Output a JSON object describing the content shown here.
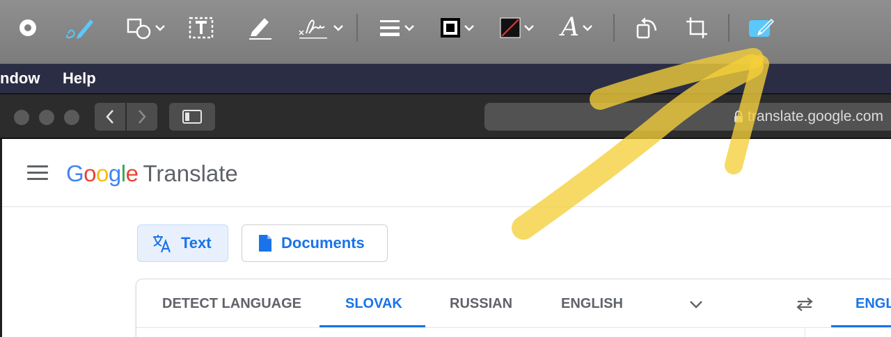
{
  "toolbar": {
    "tools": [
      {
        "name": "record-icon"
      },
      {
        "name": "sketch-icon"
      },
      {
        "name": "shapes-icon"
      },
      {
        "name": "text-box-icon"
      },
      {
        "name": "highlight-icon"
      },
      {
        "name": "signature-icon"
      },
      {
        "name": "line-style-icon"
      },
      {
        "name": "border-color-icon"
      },
      {
        "name": "fill-color-icon"
      },
      {
        "name": "text-style-icon"
      },
      {
        "name": "rotate-icon"
      },
      {
        "name": "crop-icon"
      },
      {
        "name": "annotate-icon"
      }
    ],
    "text_style_glyph": "A",
    "accent_color": "#5ac8fa"
  },
  "menubar": {
    "items": [
      "ndow",
      "Help"
    ]
  },
  "browser": {
    "url": "translate.google.com"
  },
  "app": {
    "logo_parts": [
      {
        "text": "G",
        "color": "#4285f4"
      },
      {
        "text": "o",
        "color": "#ea4335"
      },
      {
        "text": "o",
        "color": "#fbbc05"
      },
      {
        "text": "g",
        "color": "#4285f4"
      },
      {
        "text": "l",
        "color": "#34a853"
      },
      {
        "text": "e",
        "color": "#ea4335"
      }
    ],
    "product": "Translate",
    "modes": {
      "text": "Text",
      "documents": "Documents"
    },
    "languages": {
      "detect": "DETECT LANGUAGE",
      "slovak": "SLOVAK",
      "russian": "RUSSIAN",
      "english": "ENGLISH",
      "target_english": "ENGLI"
    },
    "active_language": "SLOVAK",
    "accent_color": "#1a73e8"
  },
  "annotation": {
    "color": "#f5cf3a"
  }
}
